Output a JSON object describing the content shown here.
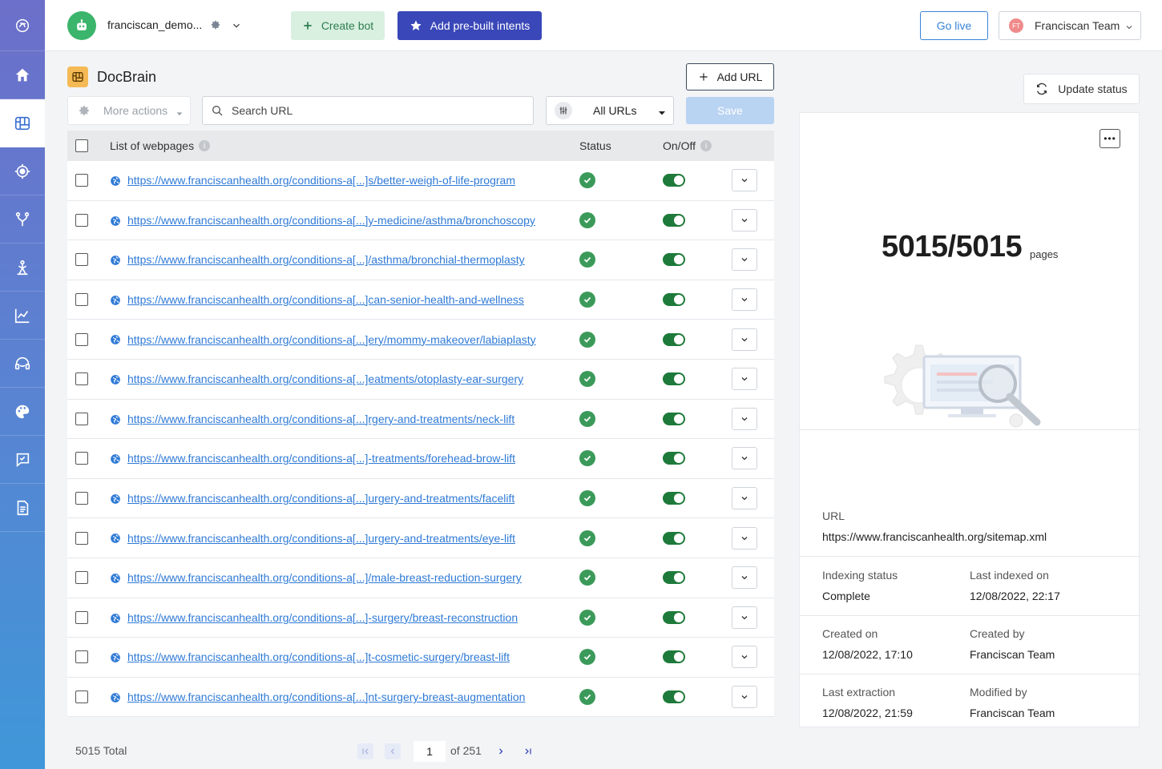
{
  "topbar": {
    "bot_name": "franciscan_demo...",
    "create_bot": "Create bot",
    "add_prebuilt": "Add pre-built intents",
    "go_live": "Go live",
    "team_initials": "FT",
    "team_name": "Franciscan Team"
  },
  "sidebar": {
    "items": [
      "logo-icon",
      "home-icon",
      "docbrain-icon",
      "target-icon",
      "flow-icon",
      "training-icon",
      "analytics-icon",
      "support-icon",
      "palette-icon",
      "chat-review-icon",
      "document-icon"
    ],
    "active": "docbrain-icon"
  },
  "page": {
    "title": "DocBrain",
    "add_url": "Add URL",
    "more_actions": "More actions",
    "search_placeholder": "Search URL",
    "filter_value": "All URLs",
    "save": "Save"
  },
  "table": {
    "col_list": "List of webpages",
    "col_status": "Status",
    "col_onoff": "On/Off",
    "rows": [
      {
        "url": "https://www.franciscanhealth.org/conditions-a[...]s/better-weigh-of-life-program",
        "status": "ok",
        "on": true
      },
      {
        "url": "https://www.franciscanhealth.org/conditions-a[...]y-medicine/asthma/bronchoscopy",
        "status": "ok",
        "on": true
      },
      {
        "url": "https://www.franciscanhealth.org/conditions-a[...]/asthma/bronchial-thermoplasty",
        "status": "ok",
        "on": true
      },
      {
        "url": "https://www.franciscanhealth.org/conditions-a[...]can-senior-health-and-wellness",
        "status": "ok",
        "on": true
      },
      {
        "url": "https://www.franciscanhealth.org/conditions-a[...]ery/mommy-makeover/labiaplasty",
        "status": "ok",
        "on": true
      },
      {
        "url": "https://www.franciscanhealth.org/conditions-a[...]eatments/otoplasty-ear-surgery",
        "status": "ok",
        "on": true
      },
      {
        "url": "https://www.franciscanhealth.org/conditions-a[...]rgery-and-treatments/neck-lift",
        "status": "ok",
        "on": true
      },
      {
        "url": "https://www.franciscanhealth.org/conditions-a[...]-treatments/forehead-brow-lift",
        "status": "ok",
        "on": true
      },
      {
        "url": "https://www.franciscanhealth.org/conditions-a[...]urgery-and-treatments/facelift",
        "status": "ok",
        "on": true
      },
      {
        "url": "https://www.franciscanhealth.org/conditions-a[...]urgery-and-treatments/eye-lift",
        "status": "ok",
        "on": true
      },
      {
        "url": "https://www.franciscanhealth.org/conditions-a[...]/male-breast-reduction-surgery",
        "status": "ok",
        "on": true
      },
      {
        "url": "https://www.franciscanhealth.org/conditions-a[...]-surgery/breast-reconstruction",
        "status": "ok",
        "on": true
      },
      {
        "url": "https://www.franciscanhealth.org/conditions-a[...]t-cosmetic-surgery/breast-lift",
        "status": "ok",
        "on": true
      },
      {
        "url": "https://www.franciscanhealth.org/conditions-a[...]nt-surgery-breast-augmentation",
        "status": "ok",
        "on": true
      }
    ]
  },
  "footer": {
    "total": "5015 Total",
    "page_value": "1",
    "of_pages": "of 251"
  },
  "panel": {
    "update_status": "Update status",
    "pages_count": "5015/5015",
    "pages_label": "pages",
    "url_label": "URL",
    "url_value": "https://www.franciscanhealth.org/sitemap.xml",
    "indexing_status_label": "Indexing status",
    "indexing_status_value": "Complete",
    "last_indexed_label": "Last indexed on",
    "last_indexed_value": "12/08/2022, 22:17",
    "created_on_label": "Created on",
    "created_on_value": "12/08/2022, 17:10",
    "created_by_label": "Created by",
    "created_by_value": "Franciscan Team",
    "last_extraction_label": "Last extraction",
    "last_extraction_value": "12/08/2022, 21:59",
    "modified_by_label": "Modified by",
    "modified_by_value": "Franciscan Team"
  },
  "colors": {
    "primary": "#3a47b8",
    "link": "#2f7ad6",
    "success": "#3b9a5a",
    "toggle_on": "#1e7a3a",
    "create_bg": "#d9f0e1"
  }
}
